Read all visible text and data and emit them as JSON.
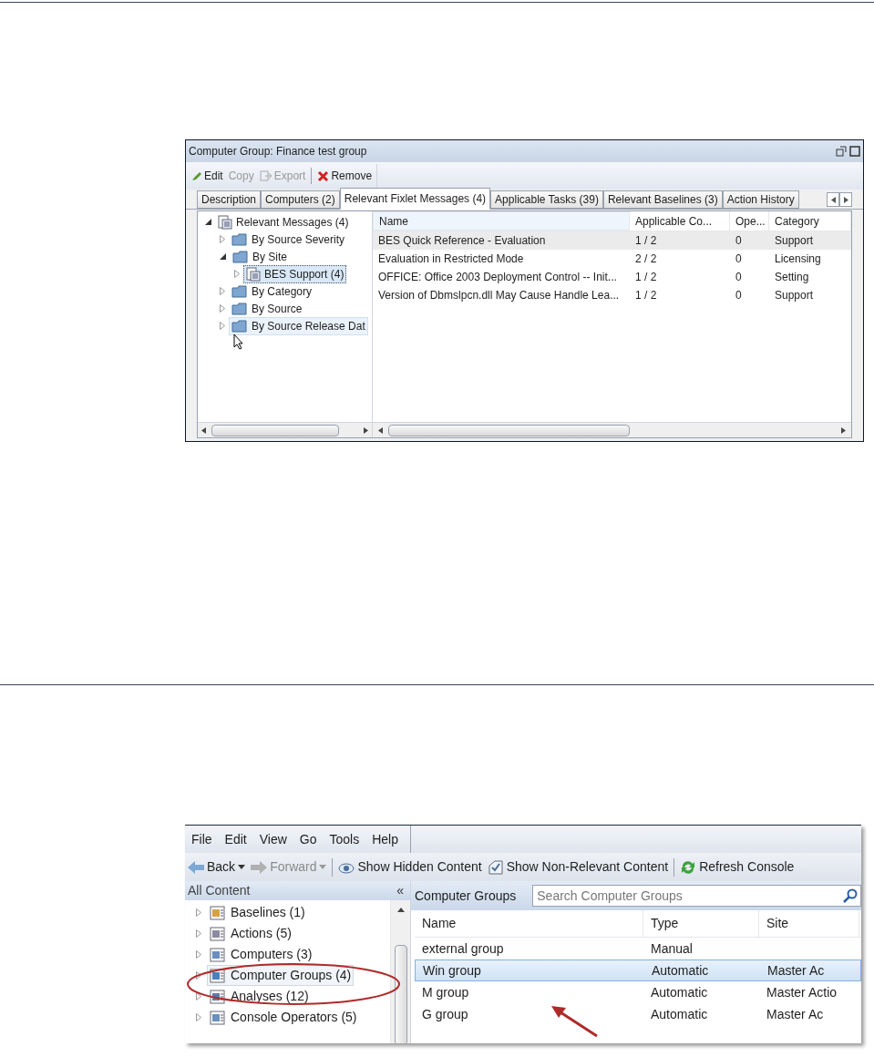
{
  "figure_1": {
    "title": "Computer Group: Finance test group",
    "toolbar": [
      {
        "label": "Edit",
        "kind": "edit",
        "disabled": false
      },
      {
        "label": "Copy",
        "kind": "copy",
        "disabled": true
      },
      {
        "label": "Export",
        "kind": "export",
        "disabled": true
      },
      {
        "label": "Remove",
        "kind": "remove",
        "disabled": false
      }
    ],
    "tabs": [
      {
        "label": "Description",
        "selected": false
      },
      {
        "label": "Computers (2)",
        "selected": false
      },
      {
        "label": "Relevant Fixlet Messages (4)",
        "selected": true
      },
      {
        "label": "Applicable Tasks (39)",
        "selected": false
      },
      {
        "label": "Relevant Baselines (3)",
        "selected": false
      },
      {
        "label": "Action History",
        "selected": false
      }
    ],
    "tree": [
      {
        "label": "Relevant Messages (4)",
        "kind": "messages",
        "expanded": true,
        "selected": false,
        "hovered": false,
        "children": [
          {
            "label": "By Source Severity",
            "kind": "folder",
            "expanded": false,
            "selected": false,
            "hovered": false
          },
          {
            "label": "By Site",
            "kind": "folder",
            "expanded": true,
            "selected": false,
            "hovered": false,
            "children": [
              {
                "label": "BES Support (4)",
                "kind": "messages",
                "expanded": false,
                "selected": true,
                "hovered": false
              }
            ]
          },
          {
            "label": "By Category",
            "kind": "folder",
            "expanded": false,
            "selected": false,
            "hovered": false
          },
          {
            "label": "By Source",
            "kind": "folder",
            "expanded": false,
            "selected": false,
            "hovered": false
          },
          {
            "label": "By Source Release Dat",
            "kind": "folder",
            "expanded": false,
            "selected": false,
            "hovered": true
          }
        ]
      }
    ],
    "table": {
      "columns": [
        "Name",
        "Applicable Co...",
        "Ope...",
        "Category"
      ],
      "rows": [
        {
          "cells": [
            "BES Quick Reference - Evaluation",
            "1 / 2",
            "0",
            "Support"
          ],
          "selected": true
        },
        {
          "cells": [
            "Evaluation in Restricted Mode",
            "2 / 2",
            "0",
            "Licensing"
          ],
          "selected": false
        },
        {
          "cells": [
            "OFFICE: Office 2003 Deployment Control -- Init...",
            "1 / 2",
            "0",
            "Setting"
          ],
          "selected": false
        },
        {
          "cells": [
            "Version of Dbmslpcn.dll May Cause Handle Lea...",
            "1 / 2",
            "0",
            "Support"
          ],
          "selected": false
        }
      ]
    }
  },
  "figure_2": {
    "menu": [
      "File",
      "Edit",
      "View",
      "Go",
      "Tools",
      "Help"
    ],
    "toolbar": [
      {
        "label": "Back",
        "kind": "back",
        "disabled": false,
        "dropdown": true
      },
      {
        "label": "Forward",
        "kind": "forward",
        "disabled": true,
        "dropdown": true
      },
      {
        "label": "Show Hidden Content",
        "kind": "eye",
        "disabled": false,
        "dropdown": false
      },
      {
        "label": "Show Non-Relevant Content",
        "kind": "check",
        "disabled": false,
        "dropdown": false
      },
      {
        "label": "Refresh Console",
        "kind": "refresh",
        "disabled": false,
        "dropdown": false
      }
    ],
    "nav_title": "All Content",
    "collapse_glyph": "«",
    "nav": [
      {
        "label": "Baselines (1)",
        "kind": "baseline",
        "hovered": false
      },
      {
        "label": "Actions (5)",
        "kind": "action",
        "hovered": false
      },
      {
        "label": "Computers (3)",
        "kind": "computer",
        "hovered": false
      },
      {
        "label": "Computer Groups (4)",
        "kind": "group",
        "hovered": true
      },
      {
        "label": "Analyses (12)",
        "kind": "analysis",
        "hovered": false
      },
      {
        "label": "Console Operators (5)",
        "kind": "operator",
        "hovered": false
      }
    ],
    "pane_title": "Computer Groups",
    "search": {
      "placeholder": "Search Computer Groups"
    },
    "table": {
      "columns": [
        "Name",
        "Type",
        "Site"
      ],
      "rows": [
        {
          "cells": [
            "external group",
            "Manual",
            ""
          ],
          "selected": false
        },
        {
          "cells": [
            "Win group",
            "Automatic",
            "Master Ac"
          ],
          "selected": true
        },
        {
          "cells": [
            "M group",
            "Automatic",
            "Master Actio"
          ],
          "selected": false
        },
        {
          "cells": [
            "G group",
            "Automatic",
            "Master Ac"
          ],
          "selected": false
        }
      ]
    }
  }
}
